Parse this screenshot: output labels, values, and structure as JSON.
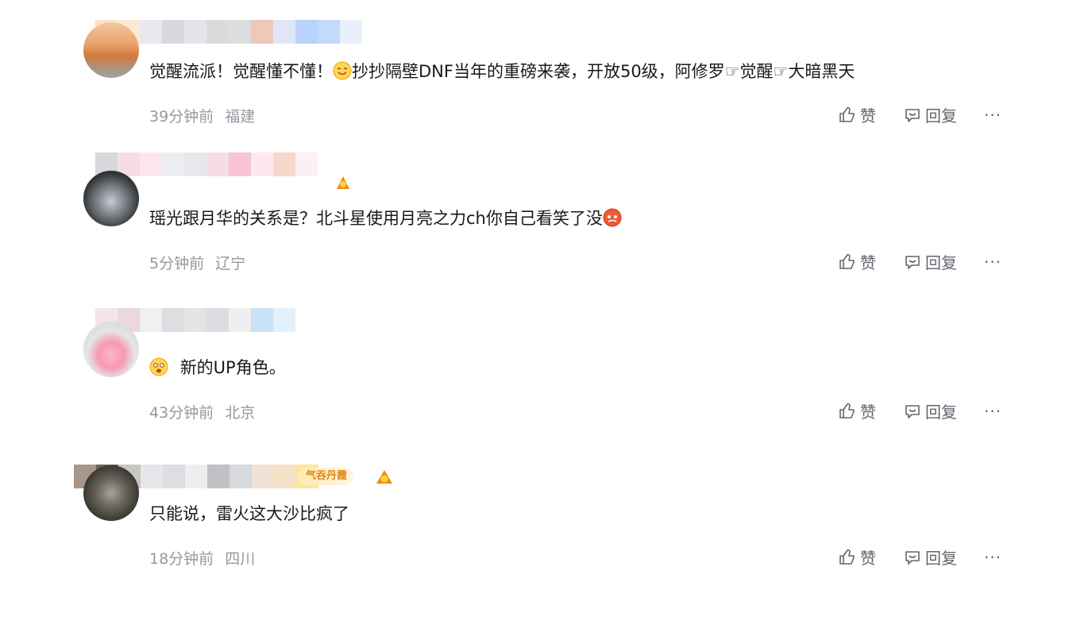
{
  "comments": [
    {
      "text": "觉醒流派！觉醒懂不懂！",
      "text_after_emoji": "抄抄隔壁DNF当年的重磅来袭，开放50级，阿修罗☞觉醒☞大暗黑天",
      "time": "39分钟前",
      "location": "福建"
    },
    {
      "text": "瑶光跟月华的关系是？北斗星使用月亮之力ch你自己看笑了没",
      "time": "5分钟前",
      "location": "辽宁"
    },
    {
      "text": "新的UP角色。",
      "time": "43分钟前",
      "location": "北京"
    },
    {
      "badge": "气吞丹霞",
      "text": "只能说，雷火这大沙比疯了",
      "time": "18分钟前",
      "location": "四川"
    }
  ],
  "actions": {
    "like_label": "赞",
    "reply_label": "回复",
    "more_label": "···"
  },
  "icons": {
    "like": "thumbs-up-icon",
    "reply": "speech-bubble-icon",
    "more": "more-dots-icon"
  },
  "colors": {
    "text": "#18191c",
    "meta": "#9499a0",
    "action": "#61666d",
    "badge_text": "#e08a1a"
  }
}
